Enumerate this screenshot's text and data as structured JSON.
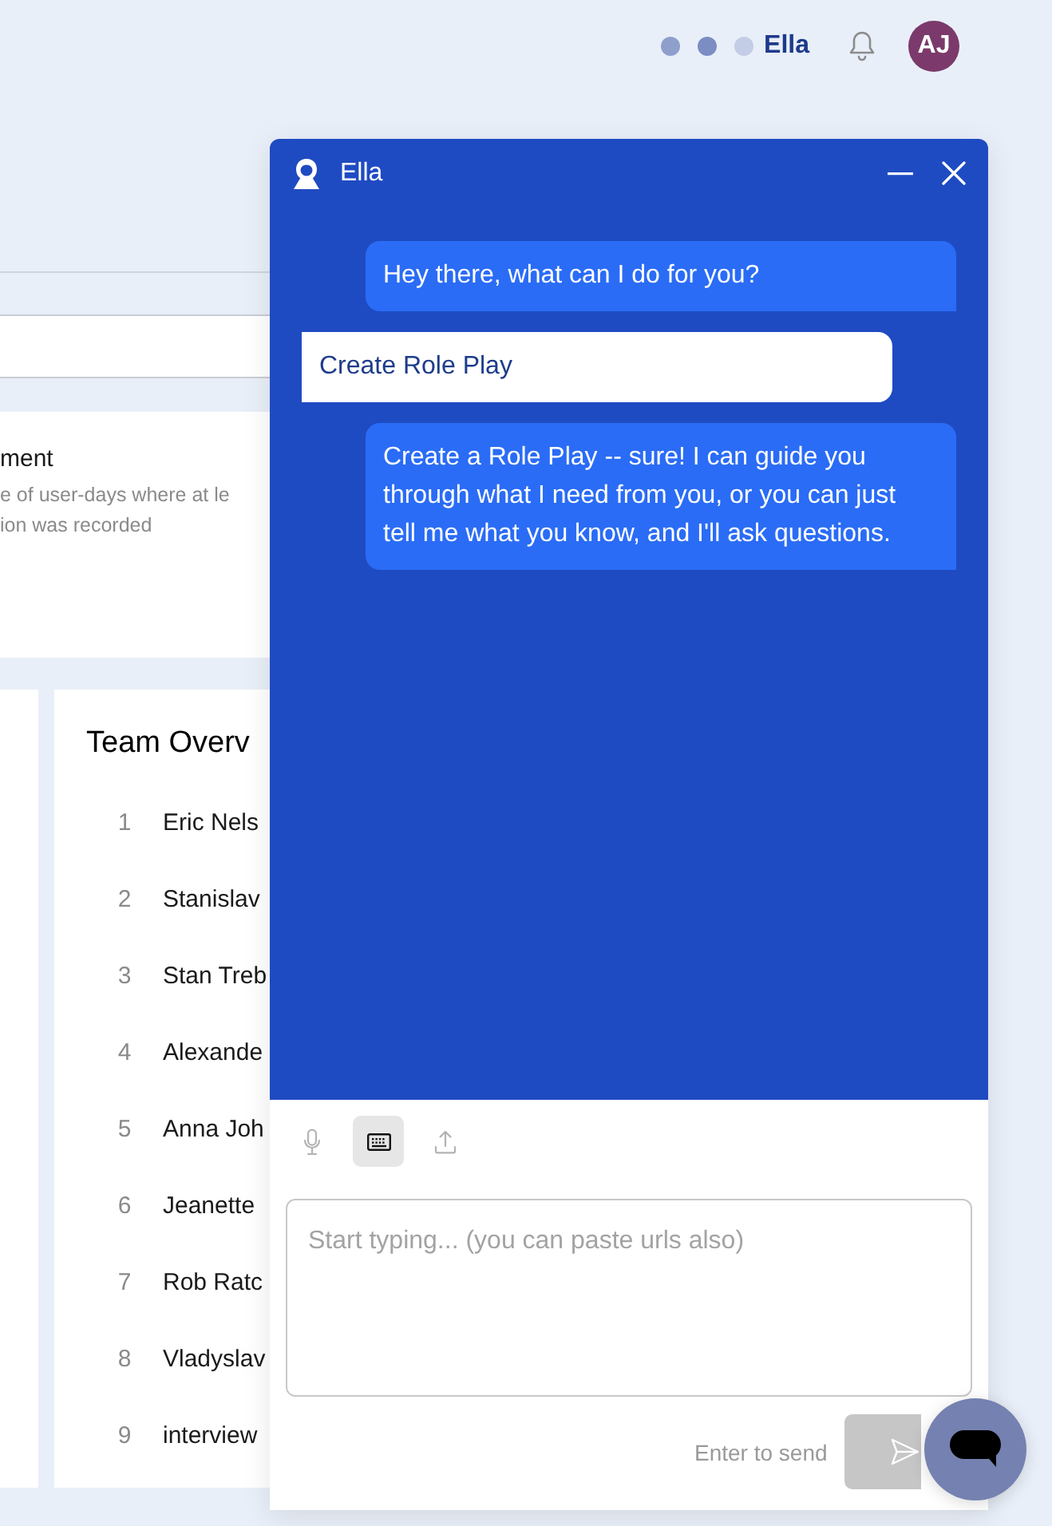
{
  "top_bar": {
    "status_dots": [
      {
        "color": "#8e9fcc"
      },
      {
        "color": "#7b8dc2"
      },
      {
        "color": "#c3cde6"
      }
    ],
    "assistant_name": "Ella",
    "avatar": {
      "initials": "AJ"
    }
  },
  "background": {
    "metric_card": {
      "title": "ment",
      "description": "e of user-days where at le\nion was recorded"
    },
    "team_overview": {
      "title": "Team Overv",
      "rows": [
        {
          "rank": "1",
          "name": "Eric Nels"
        },
        {
          "rank": "2",
          "name": "Stanislav"
        },
        {
          "rank": "3",
          "name": "Stan Treb"
        },
        {
          "rank": "4",
          "name": "Alexande"
        },
        {
          "rank": "5",
          "name": "Anna Joh"
        },
        {
          "rank": "6",
          "name": "Jeanette"
        },
        {
          "rank": "7",
          "name": "Rob Ratc"
        },
        {
          "rank": "8",
          "name": "Vladyslav"
        },
        {
          "rank": "9",
          "name": "interview"
        }
      ]
    }
  },
  "chat": {
    "title": "Ella",
    "messages": [
      {
        "kind": "assistant",
        "text": "Hey there, what can I do for you?"
      },
      {
        "kind": "user",
        "text": "Create Role Play"
      },
      {
        "kind": "assistant",
        "text": "Create a Role Play -- sure! I can guide you through what I need from you, or you can just tell me what you know, and I'll ask questions."
      }
    ],
    "toolbar": [
      {
        "kind": "microphone",
        "selected": false
      },
      {
        "kind": "keyboard",
        "selected": true
      },
      {
        "kind": "upload",
        "selected": false
      }
    ],
    "composer": {
      "placeholder": "Start typing... (you can paste urls also)"
    },
    "send_hint": "Enter to send",
    "send_button": {
      "disabled": true
    }
  }
}
